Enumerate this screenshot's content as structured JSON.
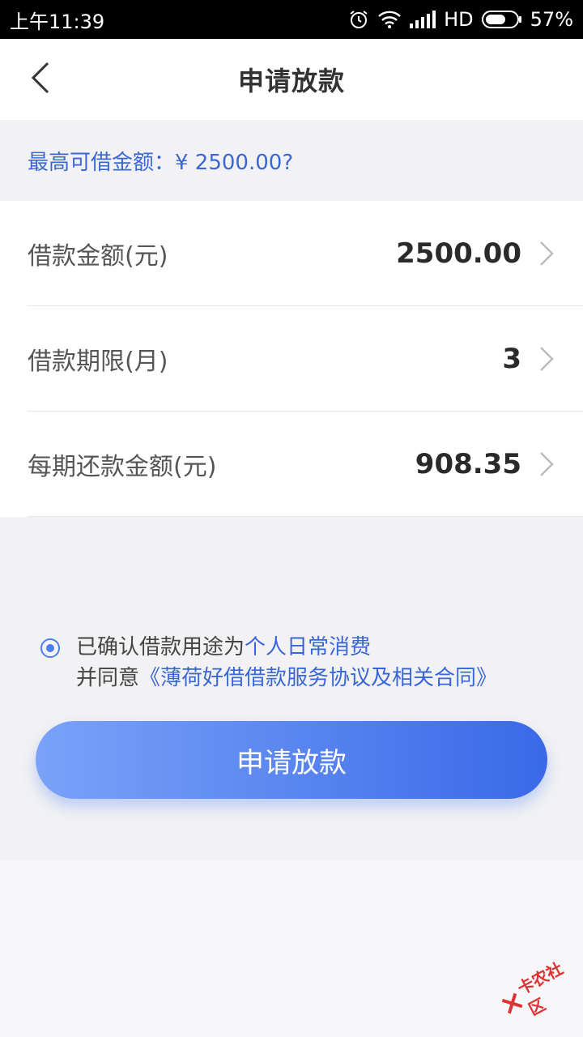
{
  "status_bar": {
    "time": "上午11:39",
    "network": "HD",
    "battery": "57%",
    "icons": [
      "alarm-icon",
      "wifi-icon",
      "signal-icon",
      "battery-icon"
    ]
  },
  "header": {
    "title": "申请放款",
    "back_icon": "chevron-left-icon"
  },
  "limit_hint": "最高可借金额：¥ 2500.00?",
  "form": {
    "rows": [
      {
        "label": "借款金额(元)",
        "value": "2500.00"
      },
      {
        "label": "借款期限(月)",
        "value": "3"
      },
      {
        "label": "每期还款金额(元)",
        "value": "908.35"
      }
    ]
  },
  "agreement": {
    "checked": true,
    "line1_prefix": "已确认借款用途为",
    "line1_link": "个人日常消费",
    "line2_prefix": "并同意",
    "line2_link": "《薄荷好借借款服务协议及相关合同》"
  },
  "submit_label": "申请放款",
  "watermark": "卡农社区",
  "colors": {
    "accent": "#3a67d6",
    "button_start": "#7aa2f9",
    "button_end": "#3a68e8",
    "watermark": "#d33333"
  }
}
